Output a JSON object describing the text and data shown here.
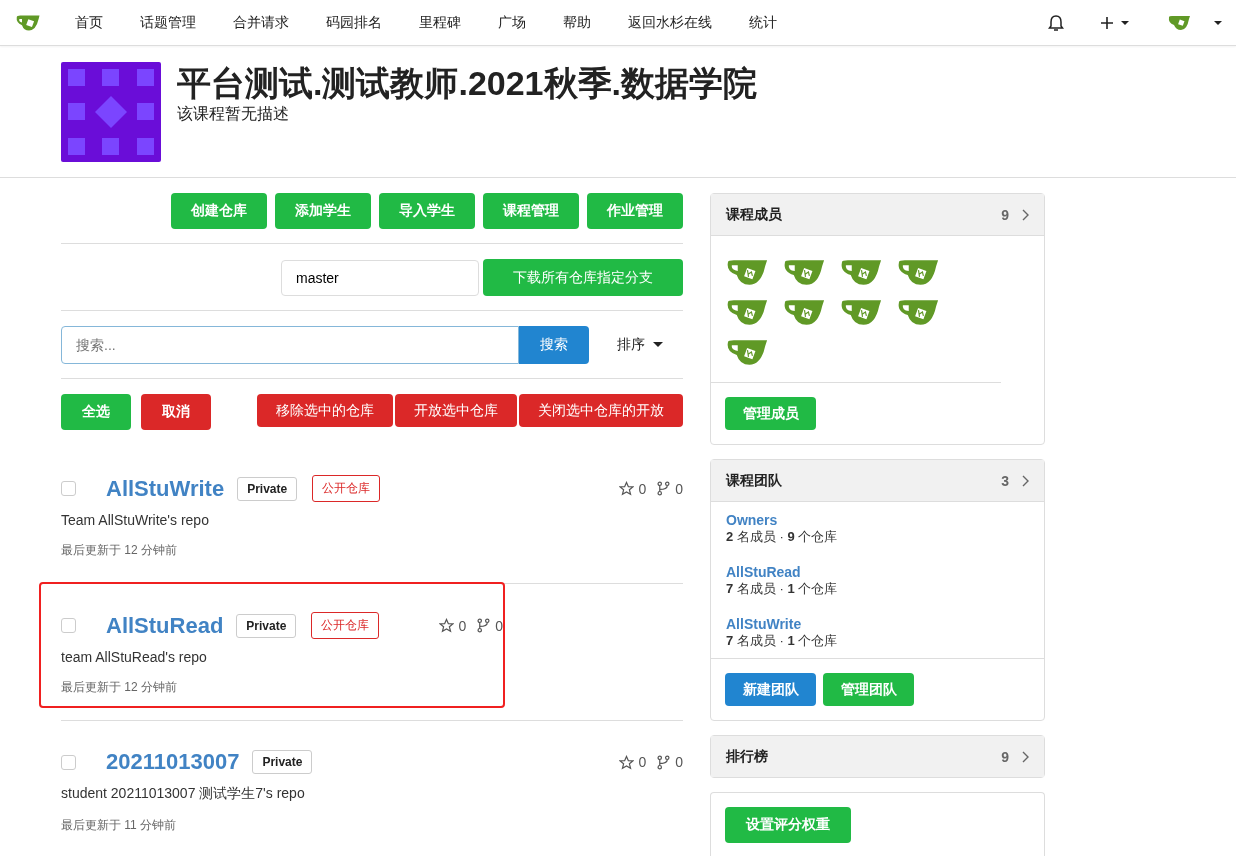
{
  "nav": {
    "items": [
      "首页",
      "话题管理",
      "合并请求",
      "码园排名",
      "里程碑",
      "广场",
      "帮助",
      "返回水杉在线",
      "统计"
    ]
  },
  "course": {
    "title": "平台测试.测试教师.2021秋季.数据学院",
    "description": "该课程暂无描述"
  },
  "actions": [
    "创建仓库",
    "添加学生",
    "导入学生",
    "课程管理",
    "作业管理"
  ],
  "branch": {
    "value": "master",
    "button": "下载所有仓库指定分支"
  },
  "search": {
    "placeholder": "搜索...",
    "button": "搜索",
    "sort": "排序"
  },
  "bulk": {
    "select_all": "全选",
    "cancel": "取消",
    "actions": [
      "移除选中的仓库",
      "开放选中仓库",
      "关闭选中仓库的开放"
    ]
  },
  "repos": [
    {
      "name": "AllStuWrite",
      "visibility": "Private",
      "tag": "公开仓库",
      "description": "Team AllStuWrite's repo",
      "updated": "最后更新于 12 分钟前",
      "star_count": "0",
      "fork_count": "0",
      "checked": false,
      "highlighted": false
    },
    {
      "name": "AllStuRead",
      "visibility": "Private",
      "tag": "公开仓库",
      "description": "team AllStuRead's repo",
      "updated": "最后更新于 12 分钟前",
      "star_count": "0",
      "fork_count": "0",
      "checked": false,
      "highlighted": true
    },
    {
      "name": "20211013007",
      "visibility": "Private",
      "description": "student 20211013007 测试学生7's repo",
      "updated": "最后更新于 11 分钟前",
      "star_count": "0",
      "fork_count": "0",
      "checked": false,
      "highlighted": false
    }
  ],
  "sidebar": {
    "members": {
      "title": "课程成员",
      "count": "9",
      "avatars": [
        {
          "kind": "default"
        },
        {
          "kind": "default"
        },
        {
          "kind": "default"
        },
        {
          "kind": "default"
        },
        {
          "kind": "default"
        },
        {
          "kind": "default"
        },
        {
          "kind": "default"
        },
        {
          "kind": "default"
        },
        {
          "kind": "default"
        }
      ],
      "button": "管理成员"
    },
    "teams": {
      "title": "课程团队",
      "count": "3",
      "items": [
        {
          "name": "Owners",
          "stats": "**2** 名成员 · **9** 个仓库"
        },
        {
          "name": "AllStuRead",
          "stats": "**7** 名成员 · **1** 个仓库"
        },
        {
          "name": "AllStuWrite",
          "stats": "**7** 名成员 · **1** 个仓库"
        }
      ],
      "buttons": [
        {
          "label": "新建团队",
          "kind": "primary"
        },
        {
          "label": "管理团队",
          "kind": "success"
        }
      ]
    },
    "ranking": {
      "title": "排行榜",
      "count": "9"
    },
    "weights": {
      "button": "设置评分权重"
    }
  }
}
